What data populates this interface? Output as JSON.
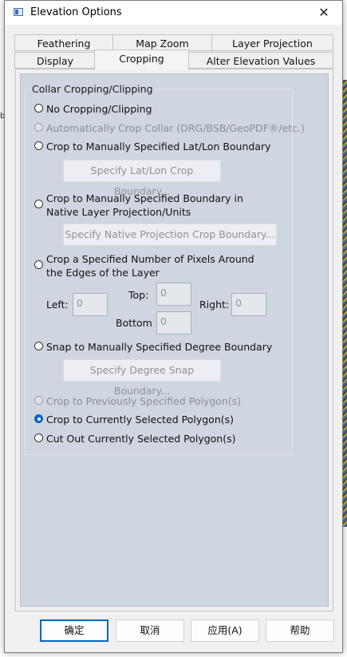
{
  "window": {
    "title": "Elevation Options",
    "close": "✕"
  },
  "tabs_row1": [
    "Feathering",
    "Map Zoom",
    "Layer Projection"
  ],
  "tabs_row2": [
    "Display",
    "Cropping",
    "Alter Elevation Values"
  ],
  "active_tab": "Cropping",
  "group": {
    "title": "Collar Cropping/Clipping",
    "options": {
      "no_crop": "No Cropping/Clipping",
      "auto_crop": "Automatically Crop Collar (DRG/BSB/GeoPDF®/etc.)",
      "latlon": "Crop to Manually Specified Lat/Lon Boundary",
      "native": "Crop to Manually Specified Boundary in Native Layer Projection/Units",
      "pixels": "Crop a Specified Number of Pixels Around the Edges of the Layer",
      "snap": "Snap to Manually Specified Degree Boundary",
      "prev_polygon": "Crop to Previously Specified Polygon(s)",
      "cur_polygon": "Crop to Currently Selected Polygon(s)",
      "cut_out": "Cut Out Currently Selected Polygon(s)"
    },
    "selected": "cur_polygon",
    "buttons": {
      "latlon": "Specify Lat/Lon Crop Boundary...",
      "native": "Specify Native Projection Crop Boundary...",
      "snap": "Specify Degree Snap Boundary..."
    },
    "pixel_fields": {
      "left_label": "Left:",
      "left_value": "0",
      "top_label": "Top:",
      "top_value": "0",
      "right_label": "Right:",
      "right_value": "0",
      "bottom_label": "Bottom",
      "bottom_value": "0"
    }
  },
  "footer": {
    "ok": "确定",
    "cancel": "取消",
    "apply": "应用(A)",
    "help": "帮助"
  },
  "background": {
    "left_fragment": "b"
  },
  "colors": {
    "accent": "#0067c0",
    "panel": "#cfd6e0"
  },
  "icons": {
    "window_icon": "dialog-window-icon",
    "close": "close-icon"
  }
}
